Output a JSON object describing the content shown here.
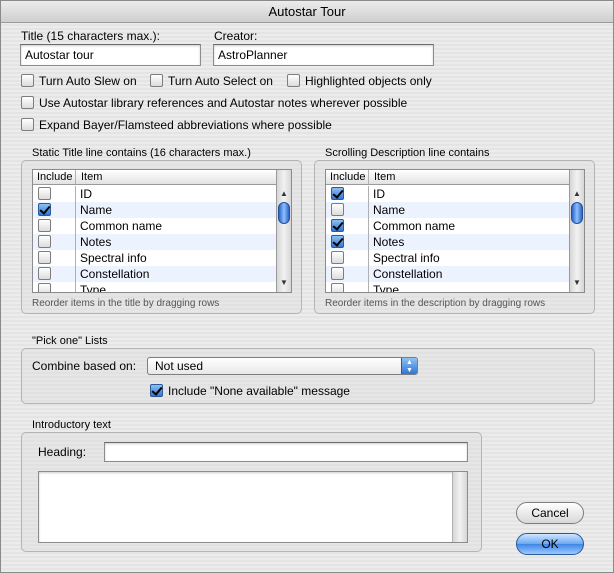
{
  "window": {
    "title": "Autostar Tour"
  },
  "title_field": {
    "label": "Title (15 characters max.):",
    "value": "Autostar tour"
  },
  "creator_field": {
    "label": "Creator:",
    "value": "AstroPlanner"
  },
  "options": {
    "auto_slew": {
      "label": "Turn Auto Slew on",
      "checked": false
    },
    "auto_select": {
      "label": "Turn Auto Select on",
      "checked": false
    },
    "highlighted_only": {
      "label": "Highlighted objects only",
      "checked": false
    },
    "library_refs": {
      "label": "Use Autostar library references and Autostar notes wherever possible",
      "checked": false
    },
    "expand_bayer": {
      "label": "Expand Bayer/Flamsteed abbreviations where possible",
      "checked": false
    }
  },
  "static_title": {
    "group_title": "Static Title line contains (16 characters max.)",
    "col_include": "Include",
    "col_item": "Item",
    "rows": [
      {
        "item": "ID",
        "checked": false
      },
      {
        "item": "Name",
        "checked": true
      },
      {
        "item": "Common name",
        "checked": false
      },
      {
        "item": "Notes",
        "checked": false
      },
      {
        "item": "Spectral info",
        "checked": false
      },
      {
        "item": "Constellation",
        "checked": false
      },
      {
        "item": "Type",
        "checked": false
      }
    ],
    "hint": "Reorder items in the title by dragging rows"
  },
  "scrolling_desc": {
    "group_title": "Scrolling Description line contains",
    "col_include": "Include",
    "col_item": "Item",
    "rows": [
      {
        "item": "ID",
        "checked": true
      },
      {
        "item": "Name",
        "checked": false
      },
      {
        "item": "Common name",
        "checked": true
      },
      {
        "item": "Notes",
        "checked": true
      },
      {
        "item": "Spectral info",
        "checked": false
      },
      {
        "item": "Constellation",
        "checked": false
      },
      {
        "item": "Type",
        "checked": false
      }
    ],
    "hint": "Reorder items in the description by dragging rows"
  },
  "pick_one": {
    "group_title": "\"Pick one\" Lists",
    "combine_label": "Combine based on:",
    "combine_value": "Not used",
    "none_available": {
      "label": "Include \"None available\" message",
      "checked": true
    }
  },
  "intro": {
    "group_title": "Introductory text",
    "heading_label": "Heading:",
    "heading_value": "",
    "body_value": ""
  },
  "buttons": {
    "cancel": "Cancel",
    "ok": "OK"
  },
  "colors": {
    "accent": "#2f77d6",
    "row_alt": "#edf3fe"
  },
  "icons": {
    "scroll_up": "triangle-up-icon",
    "scroll_down": "triangle-down-icon",
    "popup": "updown-chevron-icon",
    "checkmark": "checkmark-icon"
  }
}
